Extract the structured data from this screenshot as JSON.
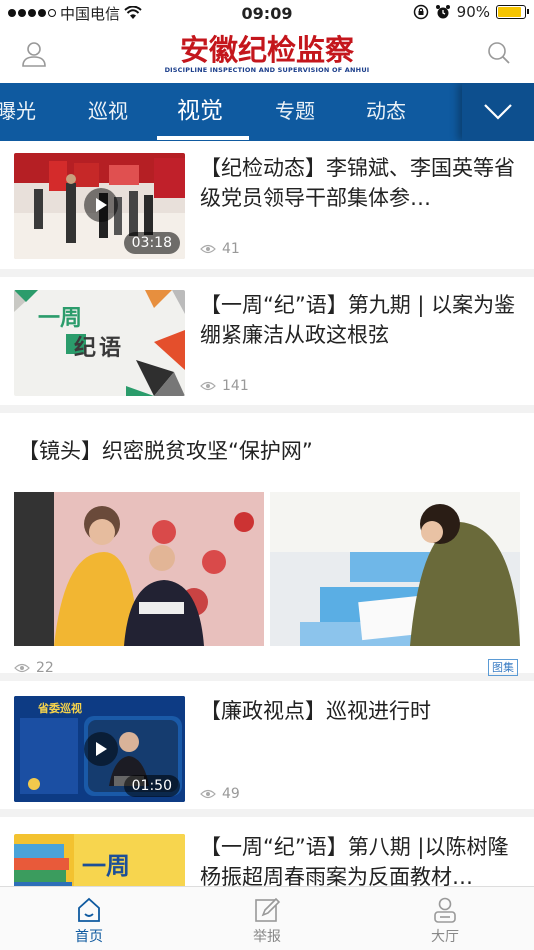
{
  "status_bar": {
    "carrier": "中国电信",
    "time": "09:09",
    "battery": "90%",
    "battery_level": 0.9
  },
  "header": {
    "logo_cn": "安徽纪检监察",
    "logo_en": "DISCIPLINE INSPECTION AND SUPERVISION OF ANHUI"
  },
  "tabs": [
    {
      "label": "曝光",
      "active": false
    },
    {
      "label": "巡视",
      "active": false
    },
    {
      "label": "视觉",
      "active": true
    },
    {
      "label": "专题",
      "active": false
    },
    {
      "label": "动态",
      "active": false
    }
  ],
  "feed": {
    "card1": {
      "title": "【纪检动态】李锦斌、李国英等省级党员领导干部集体参…",
      "views": "41",
      "duration": "03:18"
    },
    "card2": {
      "title": "【一周“纪”语】第九期 | 以案为鉴绷紧廉洁从政这根弦",
      "views": "141",
      "thumb_text_1": "一周",
      "thumb_text_2": "纪语"
    },
    "gallery": {
      "title": "【镜头】织密脱贫攻坚“保护网”",
      "views": "22",
      "tag": "图集"
    },
    "card3": {
      "title": "【廉政视点】巡视进行时",
      "views": "49",
      "duration": "01:50",
      "thumb_caption": "省委巡视"
    },
    "card4": {
      "title": "【一周“纪”语】第八期 |以陈树隆杨振超周春雨案为反面教材…",
      "thumb_text": "一周"
    }
  },
  "bottom_nav": [
    {
      "label": "首页",
      "active": true
    },
    {
      "label": "举报",
      "active": false
    },
    {
      "label": "大厅",
      "active": false
    }
  ],
  "colors": {
    "brand_blue": "#0f5aa0",
    "logo_red": "#c4161c"
  }
}
